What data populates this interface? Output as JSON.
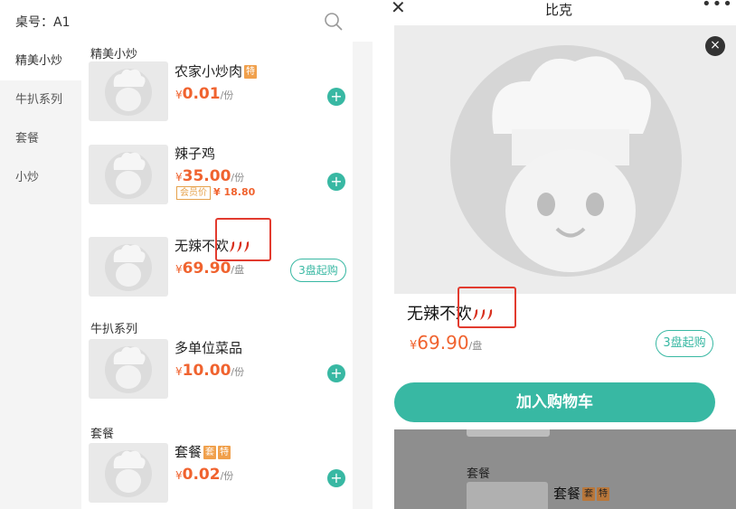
{
  "left": {
    "table_label": "桌号：A1",
    "search_icon": "search-icon",
    "sidebar": [
      {
        "label": "精美小炒",
        "active": true
      },
      {
        "label": "牛扒系列",
        "active": false
      },
      {
        "label": "套餐",
        "active": false
      },
      {
        "label": "小炒",
        "active": false
      }
    ],
    "sections": [
      {
        "title": "精美小炒"
      },
      {
        "title": "牛扒系列"
      },
      {
        "title": "套餐"
      }
    ],
    "dishes": [
      {
        "name": "农家小炒肉",
        "tags": [
          "特"
        ],
        "currency": "¥",
        "price": "0.01",
        "unit": "/份"
      },
      {
        "name": "辣子鸡",
        "currency": "¥",
        "price": "35.00",
        "unit": "/份",
        "member_label": "会员价",
        "member_price": "¥ 18.80"
      },
      {
        "name": "无辣不欢",
        "spice_level": 3,
        "currency": "¥",
        "price": "69.90",
        "unit": "/盘",
        "min_order": "3盘起购"
      },
      {
        "name": "多单位菜品",
        "currency": "¥",
        "price": "10.00",
        "unit": "/份"
      },
      {
        "name": "套餐",
        "tags": [
          "套",
          "特"
        ],
        "currency": "¥",
        "price": "0.02",
        "unit": "/份"
      }
    ],
    "add_label": "+",
    "highlight_color": "#e23b2f"
  },
  "right": {
    "close_icon": "close-icon",
    "title": "比克",
    "more_icon": "more-icon",
    "dismiss_label": "×",
    "dish_name": "无辣不欢",
    "spice_level": 3,
    "currency": "¥",
    "price": "69.90",
    "unit": "/盘",
    "min_order": "3盘起购",
    "cart_button": "加入购物车",
    "bg_section": "套餐",
    "bg_dish_name": "套餐",
    "bg_tags": [
      "套",
      "特"
    ]
  },
  "colors": {
    "accent": "#38b8a3",
    "price": "#f0632f",
    "tag": "#f0a04c"
  }
}
